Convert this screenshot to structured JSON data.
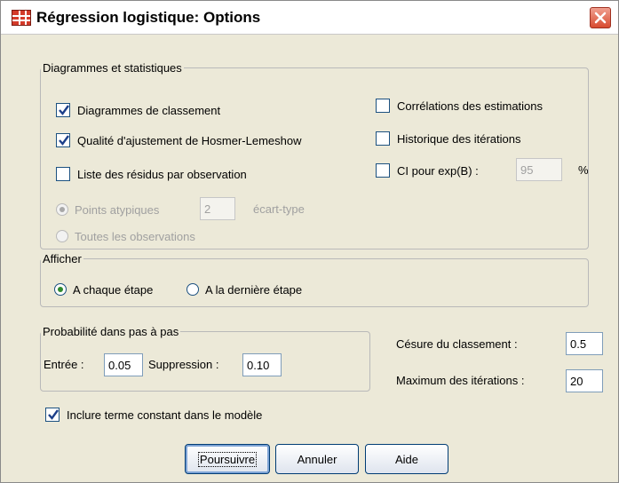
{
  "window": {
    "title": "Régression logistique: Options"
  },
  "diagrams_group": {
    "legend": "Diagrammes et statistiques",
    "classification_plots": {
      "label": "Diagrammes de classement",
      "checked": true
    },
    "hosmer_lemeshow": {
      "label": "Qualité d'ajustement de Hosmer-Lemeshow",
      "checked": true
    },
    "casewise_residuals": {
      "label": "Liste des résidus par observation",
      "checked": false
    },
    "outliers": {
      "label": "Points atypiques",
      "value": "2",
      "unit": "écart-type",
      "selected": true,
      "enabled": false
    },
    "all_cases": {
      "label": "Toutes les observations",
      "selected": false,
      "enabled": false
    },
    "correlations": {
      "label": "Corrélations des estimations",
      "checked": false
    },
    "iteration_history": {
      "label": "Historique des itérations",
      "checked": false
    },
    "ci_exp_b": {
      "label": "CI pour exp(B) :",
      "value": "95",
      "unit": "%",
      "checked": false
    }
  },
  "display_group": {
    "legend": "Afficher",
    "each_step": {
      "label": "A chaque étape",
      "selected": true
    },
    "last_step": {
      "label": "A la dernière étape",
      "selected": false
    }
  },
  "stepwise_group": {
    "legend": "Probabilité dans pas à pas",
    "entry": {
      "label": "Entrée :",
      "value": "0.05"
    },
    "removal": {
      "label": "Suppression :",
      "value": "0.10"
    }
  },
  "classification_cutoff": {
    "label": "Césure du classement :",
    "value": "0.5"
  },
  "max_iterations": {
    "label": "Maximum des itérations :",
    "value": "20"
  },
  "include_constant": {
    "label": "Inclure terme constant dans le modèle",
    "checked": true
  },
  "buttons": {
    "continue": "Poursuivre",
    "cancel": "Annuler",
    "help": "Aide"
  },
  "icons": {
    "app": "spss-grid-icon",
    "close": "close-icon",
    "check": "checkmark-icon"
  }
}
